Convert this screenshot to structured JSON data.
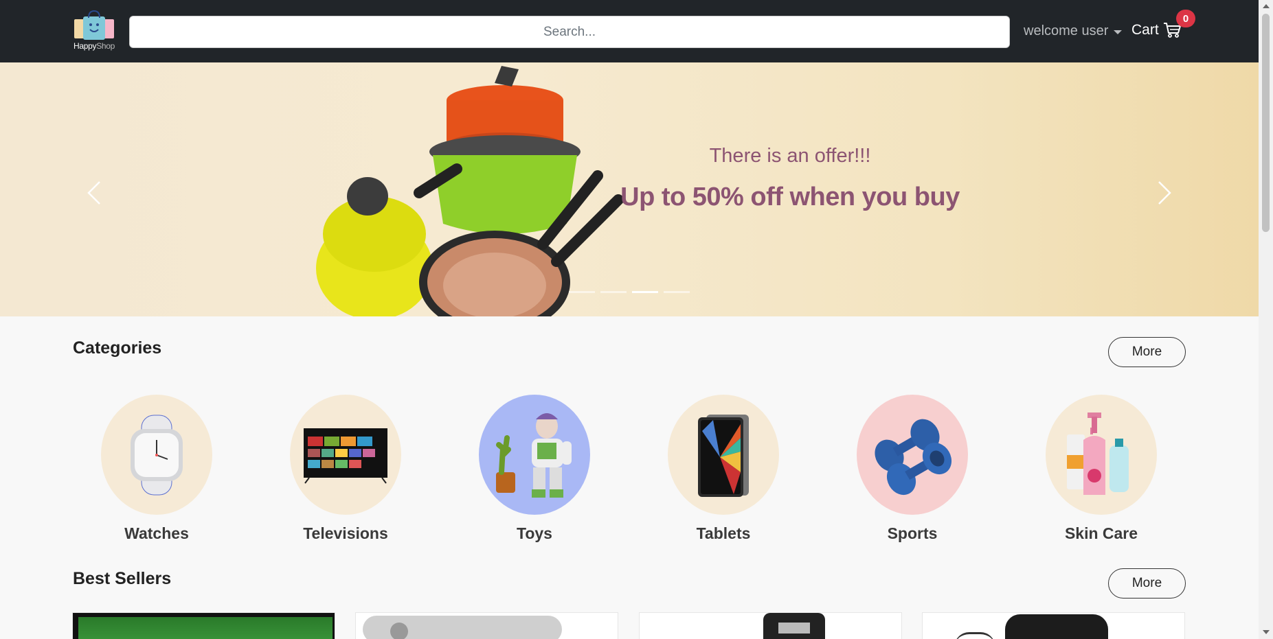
{
  "navbar": {
    "logo_text_happy": "Happy",
    "logo_text_shop": "Shop",
    "search_placeholder": "Search...",
    "user_menu_label": "welcome user",
    "cart_label": "Cart",
    "cart_count": "0"
  },
  "hero": {
    "offer_sub": "There is an offer!!!",
    "offer_main": "Up to 50% off when you buy",
    "slide_count": 4,
    "active_slide": 3
  },
  "categories": {
    "title": "Categories",
    "more_label": "More",
    "items": [
      {
        "label": "Watches",
        "icon": "watch-icon",
        "bg": "#f6ead6"
      },
      {
        "label": "Televisions",
        "icon": "television-icon",
        "bg": "#f6ead6"
      },
      {
        "label": "Toys",
        "icon": "toy-icon",
        "bg": "#a9b8f5"
      },
      {
        "label": "Tablets",
        "icon": "tablet-icon",
        "bg": "#f6ead6"
      },
      {
        "label": "Sports",
        "icon": "dumbbell-icon",
        "bg": "#f7cfcf"
      },
      {
        "label": "Skin Care",
        "icon": "skincare-icon",
        "bg": "#f6ead6"
      }
    ]
  },
  "best_sellers": {
    "title": "Best Sellers",
    "more_label": "More"
  },
  "colors": {
    "navbar_bg": "#212529",
    "badge": "#dc3545",
    "offer_text": "#8c5472"
  }
}
